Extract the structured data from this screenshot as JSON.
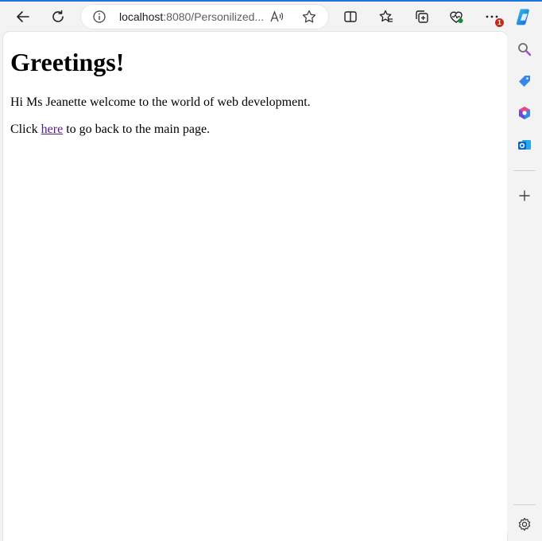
{
  "browser": {
    "address_host": "localhost",
    "address_rest": ":8080/Personilized...",
    "notification_count": "1"
  },
  "page": {
    "heading": "Greetings!",
    "greeting_text": "Hi Ms Jeanette welcome to the world of web development.",
    "return_prefix": "Click ",
    "return_link": "here",
    "return_suffix": " to go back to the main page."
  },
  "icons": {
    "toolbar": [
      "back-arrow-icon",
      "refresh-icon",
      "info-icon",
      "read-aloud-icon",
      "favorite-star-icon",
      "split-screen-icon",
      "favorites-icon",
      "collections-icon",
      "browser-essentials-icon",
      "more-icon",
      "copilot-icon"
    ],
    "sidebar": [
      "search-icon",
      "shopping-tag-icon",
      "microsoft-365-icon",
      "outlook-icon",
      "add-icon",
      "settings-icon"
    ]
  },
  "colors": {
    "accent": "#1e74d8",
    "link_visited": "#551a8b",
    "badge": "#c42b1c"
  }
}
